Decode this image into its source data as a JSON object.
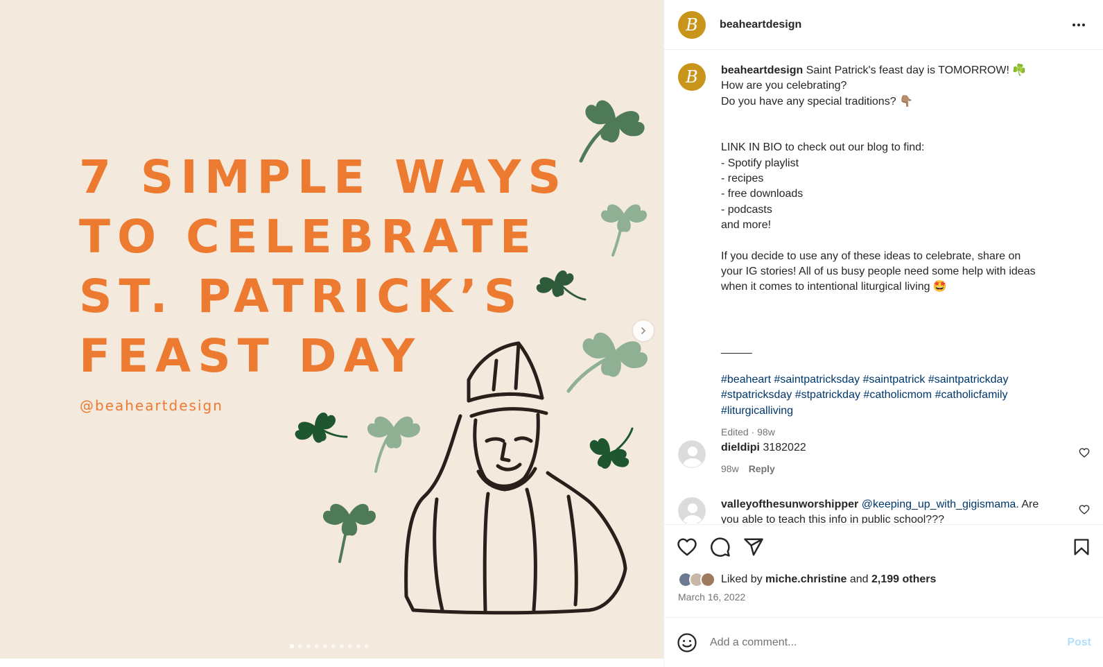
{
  "media": {
    "headline": [
      "7 SIMPLE WAYS",
      "TO CELEBRATE",
      "ST. PATRICK’S",
      "FEAST DAY"
    ],
    "handle": "@beaheartdesign",
    "colors": {
      "background": "#f4e9dd",
      "accent": "#ec7a30",
      "shamrock_dark": "#1e5630",
      "shamrock_mid": "#4f7a58",
      "shamrock_light": "#8fb093",
      "ink": "#2a1f1a"
    },
    "carousel": {
      "total": 10,
      "active": 1
    }
  },
  "header": {
    "username": "beaheartdesign",
    "avatar_letter": "B"
  },
  "caption": {
    "username": "beaheartdesign",
    "lines": [
      "Saint Patrick's feast day is TOMORROW! ☘️",
      "How are you celebrating?",
      "Do you have any special traditions? 👇🏽",
      "",
      "",
      "LINK IN BIO to check out our blog to find:",
      "- Spotify playlist",
      "- recipes",
      "- free downloads",
      "- podcasts",
      "and more!",
      "",
      "If you decide to use any of these ideas to celebrate, share on",
      "your IG stories! All of us busy people need some help with ideas",
      "when it comes to intentional liturgical living 🤩",
      "",
      "",
      "",
      "_____"
    ],
    "hashtags": [
      "#beaheart #saintpatricksday #saintpatrick #saintpatrickday",
      "#stpatricksday #stpatrickday #catholicmom #catholicfamily",
      "#liturgicalliving"
    ],
    "meta": "Edited · 98w"
  },
  "comments": [
    {
      "username": "dieldipi",
      "text": "3182022",
      "age": "98w",
      "reply": "Reply"
    },
    {
      "username": "valleyofthesunworshipper",
      "mention": "@keeping_up_with_gigismama",
      "text": ". Are",
      "text_cont": "you able to teach this info in public school???"
    }
  ],
  "likes": {
    "prefix": "Liked by",
    "user": "miche.christine",
    "middle": "and",
    "others": "2,199 others"
  },
  "date": "March 16, 2022",
  "comment_box": {
    "placeholder": "Add a comment...",
    "post_label": "Post"
  }
}
